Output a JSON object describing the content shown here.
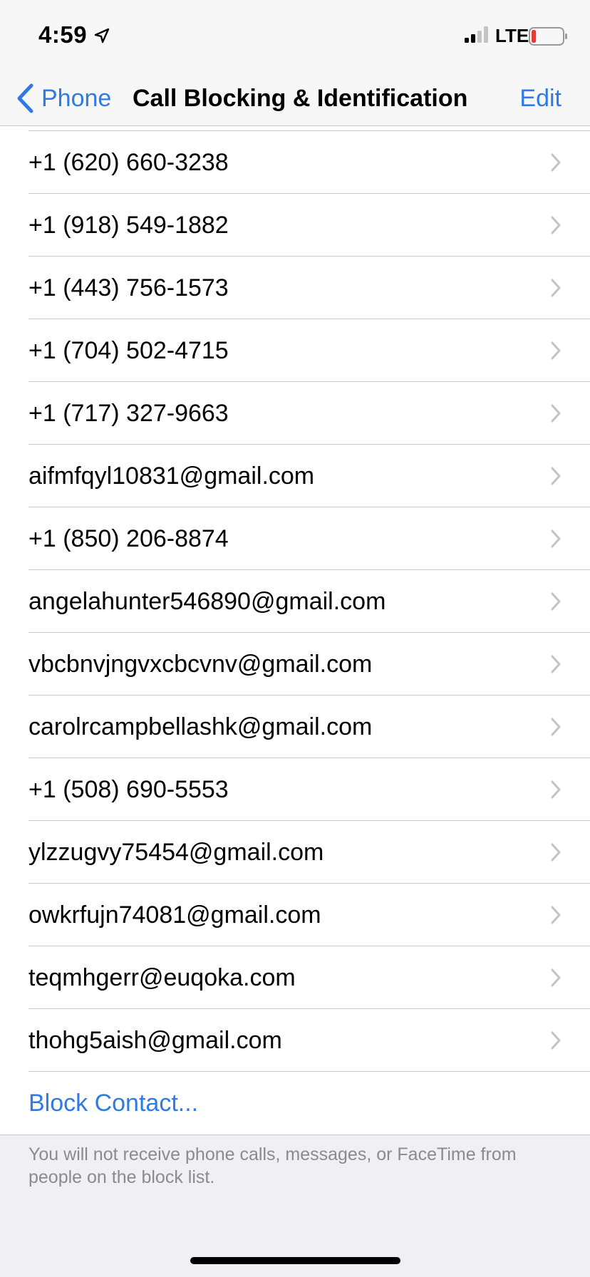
{
  "status_bar": {
    "time": "4:59",
    "network": "LTE",
    "battery_level_percent": 10,
    "battery_color": "#e53935"
  },
  "nav": {
    "back_label": "Phone",
    "title": "Call Blocking & Identification",
    "edit_label": "Edit"
  },
  "blocked_list": [
    {
      "label": "+1 (620) 660-3238"
    },
    {
      "label": "+1 (918) 549-1882"
    },
    {
      "label": "+1 (443) 756-1573"
    },
    {
      "label": "+1 (704) 502-4715"
    },
    {
      "label": "+1 (717) 327-9663"
    },
    {
      "label": "aifmfqyl10831@gmail.com"
    },
    {
      "label": "+1 (850) 206-8874"
    },
    {
      "label": "angelahunter546890@gmail.com"
    },
    {
      "label": "vbcbnvjngvxcbcvnv@gmail.com"
    },
    {
      "label": "carolrcampbellashk@gmail.com"
    },
    {
      "label": "+1 (508) 690-5553"
    },
    {
      "label": "ylzzugvy75454@gmail.com"
    },
    {
      "label": "owkrfujn74081@gmail.com"
    },
    {
      "label": "teqmhgerr@euqoka.com"
    },
    {
      "label": "thohg5aish@gmail.com"
    }
  ],
  "block_contact_label": "Block Contact...",
  "footer_note": "You will not receive phone calls, messages, or FaceTime from people on the block list.",
  "colors": {
    "accent": "#2f7ae5",
    "background": "#efeff4",
    "separator": "#c8c7cc"
  }
}
